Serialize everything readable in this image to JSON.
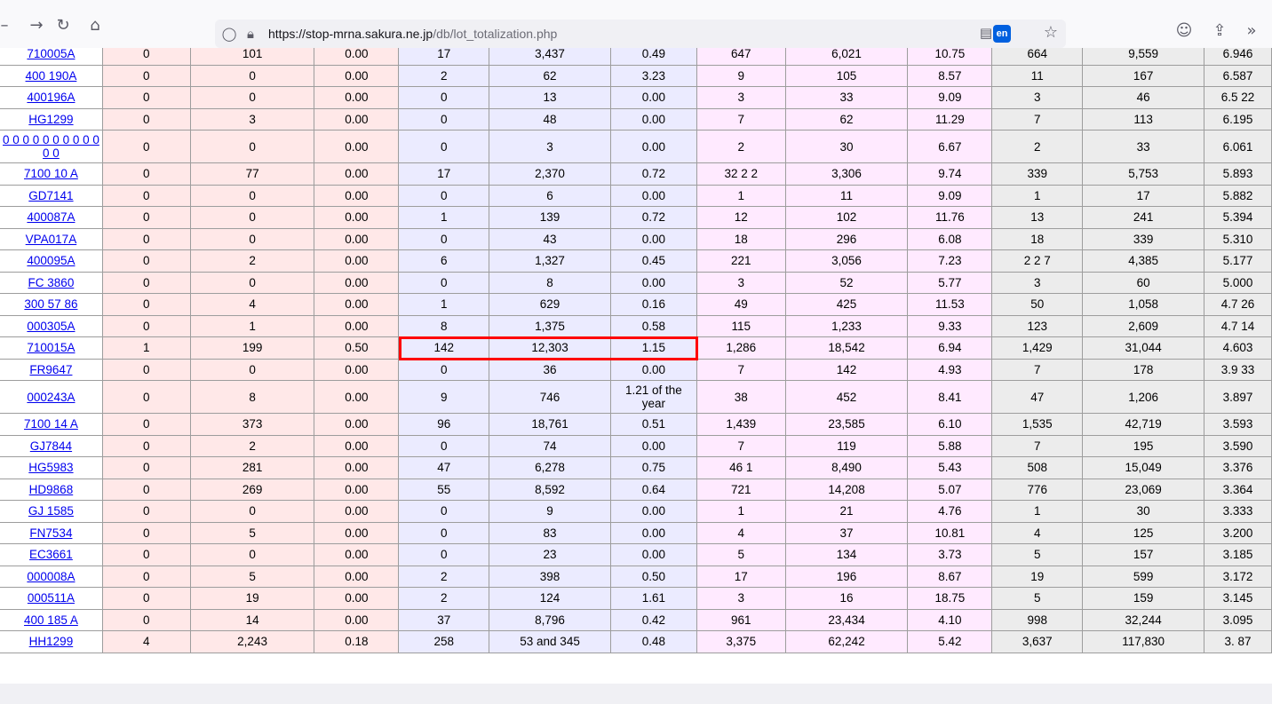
{
  "browser": {
    "url_host": "https://stop-mrna.sakura.ne.jp",
    "url_path": "/db/lot_totalization.php",
    "translate_lang": "en",
    "accent": "#0060df"
  },
  "table": {
    "highlight_color": "#ff0000",
    "rows": [
      [
        "710005A",
        "0",
        "101",
        "0.00",
        "17",
        "3,437",
        "0.49",
        "647",
        "6,021",
        "10.75",
        "664",
        "9,559",
        "6.946"
      ],
      [
        "400 190A",
        "0",
        "0",
        "0.00",
        "2",
        "62",
        "3.23",
        "9",
        "105",
        "8.57",
        "11",
        "167",
        "6.587"
      ],
      [
        "400196A",
        "0",
        "0",
        "0.00",
        "0",
        "13",
        "0.00",
        "3",
        "33",
        "9.09",
        "3",
        "46",
        "6.5 22"
      ],
      [
        "HG1299",
        "0",
        "3",
        "0.00",
        "0",
        "48",
        "0.00",
        "7",
        "62",
        "11.29",
        "7",
        "113",
        "6.195"
      ],
      [
        "0 0 0 0 0 0 0 0 0 0 0 0",
        "0",
        "0",
        "0.00",
        "0",
        "3",
        "0.00",
        "2",
        "30",
        "6.67",
        "2",
        "33",
        "6.061"
      ],
      [
        "7100 10 A",
        "0",
        "77",
        "0.00",
        "17",
        "2,370",
        "0.72",
        "32 2 2",
        "3,306",
        "9.74",
        "339",
        "5,753",
        "5.893"
      ],
      [
        "GD7141",
        "0",
        "0",
        "0.00",
        "0",
        "6",
        "0.00",
        "1",
        "11",
        "9.09",
        "1",
        "17",
        "5.882"
      ],
      [
        "400087A",
        "0",
        "0",
        "0.00",
        "1",
        "139",
        "0.72",
        "12",
        "102",
        "11.76",
        "13",
        "241",
        "5.394"
      ],
      [
        "VPA017A",
        "0",
        "0",
        "0.00",
        "0",
        "43",
        "0.00",
        "18",
        "296",
        "6.08",
        "18",
        "339",
        "5.310"
      ],
      [
        "400095A",
        "0",
        "2",
        "0.00",
        "6",
        "1,327",
        "0.45",
        "221",
        "3,056",
        "7.23",
        "2 2 7",
        "4,385",
        "5.177"
      ],
      [
        "FC 3860",
        "0",
        "0",
        "0.00",
        "0",
        "8",
        "0.00",
        "3",
        "52",
        "5.77",
        "3",
        "60",
        "5.000"
      ],
      [
        "300 57 86",
        "0",
        "4",
        "0.00",
        "1",
        "629",
        "0.16",
        "49",
        "425",
        "11.53",
        "50",
        "1,058",
        "4.7 26"
      ],
      [
        "000305A",
        "0",
        "1",
        "0.00",
        "8",
        "1,375",
        "0.58",
        "115",
        "1,233",
        "9.33",
        "123",
        "2,609",
        "4.7 14"
      ],
      [
        "710015A",
        "1",
        "199",
        "0.50",
        "142",
        "12,303",
        "1.15",
        "1,286",
        "18,542",
        "6.94",
        "1,429",
        "31,044",
        "4.603"
      ],
      [
        "FR9647",
        "0",
        "0",
        "0.00",
        "0",
        "36",
        "0.00",
        "7",
        "142",
        "4.93",
        "7",
        "178",
        "3.9 33"
      ],
      [
        "000243A",
        "0",
        "8",
        "0.00",
        "9",
        "746",
        "1.21 of the year",
        "38",
        "452",
        "8.41",
        "47",
        "1,206",
        "3.897"
      ],
      [
        "7100 14 A",
        "0",
        "373",
        "0.00",
        "96",
        "18,761",
        "0.51",
        "1,439",
        "23,585",
        "6.10",
        "1,535",
        "42,719",
        "3.593"
      ],
      [
        "GJ7844",
        "0",
        "2",
        "0.00",
        "0",
        "74",
        "0.00",
        "7",
        "119",
        "5.88",
        "7",
        "195",
        "3.590"
      ],
      [
        "HG5983",
        "0",
        "281",
        "0.00",
        "47",
        "6,278",
        "0.75",
        "46 1",
        "8,490",
        "5.43",
        "508",
        "15,049",
        "3.376"
      ],
      [
        "HD9868",
        "0",
        "269",
        "0.00",
        "55",
        "8,592",
        "0.64",
        "721",
        "14,208",
        "5.07",
        "776",
        "23,069",
        "3.364"
      ],
      [
        "GJ 1585",
        "0",
        "0",
        "0.00",
        "0",
        "9",
        "0.00",
        "1",
        "21",
        "4.76",
        "1",
        "30",
        "3.333"
      ],
      [
        "FN7534",
        "0",
        "5",
        "0.00",
        "0",
        "83",
        "0.00",
        "4",
        "37",
        "10.81",
        "4",
        "125",
        "3.200"
      ],
      [
        "EC3661",
        "0",
        "0",
        "0.00",
        "0",
        "23",
        "0.00",
        "5",
        "134",
        "3.73",
        "5",
        "157",
        "3.185"
      ],
      [
        "000008A",
        "0",
        "5",
        "0.00",
        "2",
        "398",
        "0.50",
        "17",
        "196",
        "8.67",
        "19",
        "599",
        "3.172"
      ],
      [
        "000511A",
        "0",
        "19",
        "0.00",
        "2",
        "124",
        "1.61",
        "3",
        "16",
        "18.75",
        "5",
        "159",
        "3.145"
      ],
      [
        "400 185 A",
        "0",
        "14",
        "0.00",
        "37",
        "8,796",
        "0.42",
        "961",
        "23,434",
        "4.10",
        "998",
        "32,244",
        "3.095"
      ],
      [
        "HH1299",
        "4",
        "2,243",
        "0.18",
        "258",
        "53 and 345",
        "0.48",
        "3,375",
        "62,242",
        "5.42",
        "3,637",
        "117,830",
        "3. 87"
      ]
    ]
  }
}
